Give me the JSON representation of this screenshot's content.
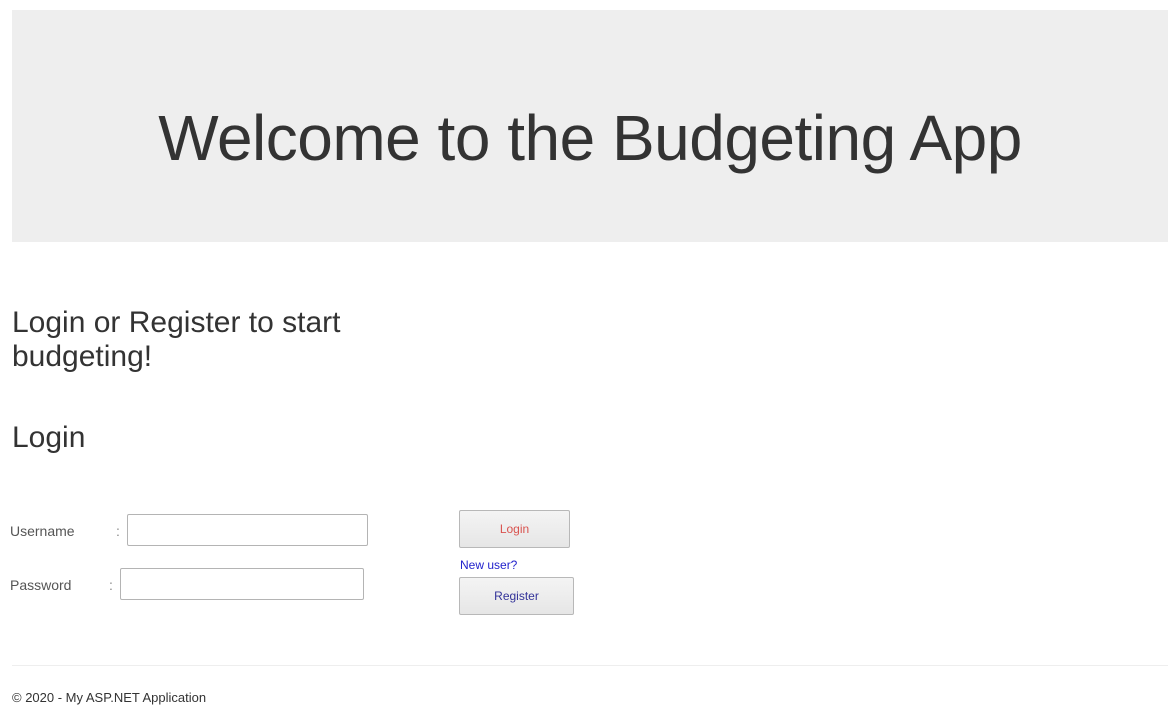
{
  "jumbotron": {
    "title": "Welcome to the Budgeting App"
  },
  "main": {
    "subtitle": "Login or Register to start budgeting!",
    "login_heading": "Login"
  },
  "form": {
    "username_label": "Username",
    "password_label": "Password",
    "separator": ":",
    "username_value": "",
    "password_value": ""
  },
  "actions": {
    "login_label": "Login",
    "new_user_label": "New user?",
    "register_label": "Register"
  },
  "footer": {
    "text": "© 2020 - My ASP.NET Application"
  },
  "colors": {
    "jumbotron_bg": "#eeeeee",
    "login_text": "#d9534f",
    "link": "#2222cc",
    "register_text": "#333399"
  }
}
